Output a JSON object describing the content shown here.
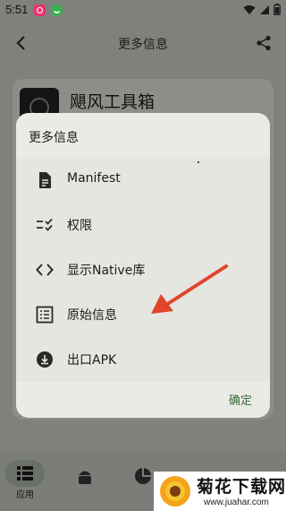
{
  "status_bar": {
    "time": "5:51"
  },
  "app_bar": {
    "title": "更多信息"
  },
  "app_info": {
    "name": "飓风工具箱"
  },
  "dialog": {
    "title": "更多信息",
    "options": [
      {
        "label": "Manifest",
        "icon": "document-icon"
      },
      {
        "label": "权限",
        "icon": "checklist-icon"
      },
      {
        "label": "显示Native库",
        "icon": "code-icon"
      },
      {
        "label": "原始信息",
        "icon": "list-icon"
      },
      {
        "label": "出口APK",
        "icon": "download-icon"
      }
    ],
    "confirm_label": "确定"
  },
  "bottom_nav": {
    "active_label": "应用"
  },
  "watermark": {
    "text": "菊花下载网",
    "url": "www.juahar.com"
  },
  "colors": {
    "arrow": "#e0452c",
    "confirm": "#3b6a3a",
    "dialog_bg": "#e9ebe5",
    "scrim": "#7f827c"
  }
}
